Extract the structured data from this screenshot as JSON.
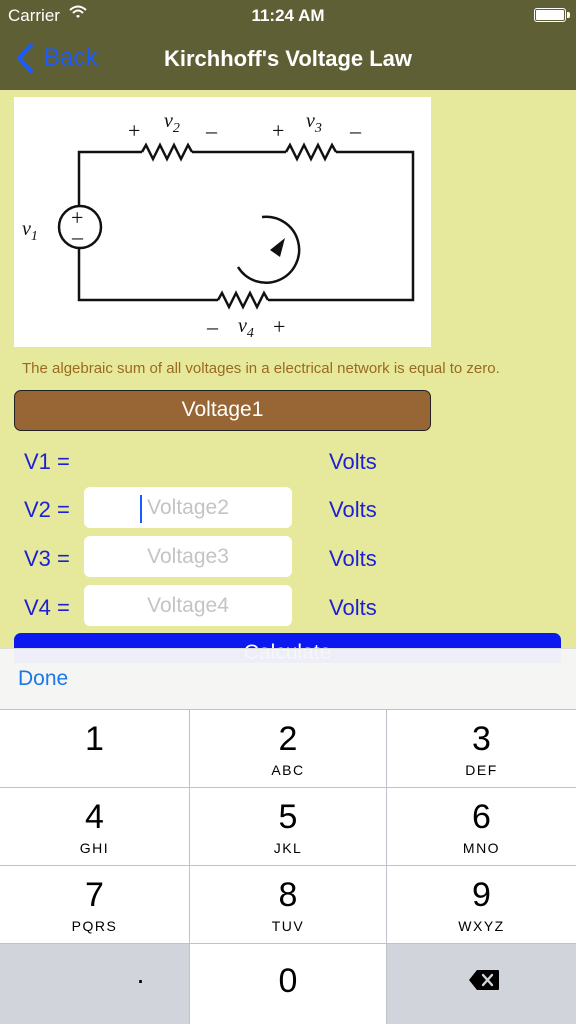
{
  "status": {
    "carrier": "Carrier",
    "time": "11:24 AM"
  },
  "nav": {
    "back_label": "Back",
    "title": "Kirchhoff's Voltage Law"
  },
  "circuit": {
    "plus": "+",
    "minus": "–",
    "v1": "v",
    "v1_sub": "1",
    "v2": "v",
    "v2_sub": "2",
    "v3": "v",
    "v3_sub": "3",
    "v4": "v",
    "v4_sub": "4"
  },
  "caption": "The algebraic sum of all voltages in a electrical network is equal to zero.",
  "voltage1_button": "Voltage1",
  "rows": [
    {
      "label": "V1 =",
      "unit": "Volts"
    },
    {
      "label": "V2 =",
      "placeholder": "Voltage2",
      "unit": "Volts"
    },
    {
      "label": "V3 =",
      "placeholder": "Voltage3",
      "unit": "Volts"
    },
    {
      "label": "V4 =",
      "placeholder": "Voltage4",
      "unit": "Volts"
    }
  ],
  "calculate_label": "Calculate",
  "keyboard": {
    "done_label": "Done",
    "keys": [
      {
        "num": "1",
        "letters": ""
      },
      {
        "num": "2",
        "letters": "ABC"
      },
      {
        "num": "3",
        "letters": "DEF"
      },
      {
        "num": "4",
        "letters": "GHI"
      },
      {
        "num": "5",
        "letters": "JKL"
      },
      {
        "num": "6",
        "letters": "MNO"
      },
      {
        "num": "7",
        "letters": "PQRS"
      },
      {
        "num": "8",
        "letters": "TUV"
      },
      {
        "num": "9",
        "letters": "WXYZ"
      },
      {
        "num": "0",
        "letters": ""
      }
    ],
    "decimal": ".",
    "delete_icon": "backspace-icon"
  },
  "colors": {
    "nav_bar": "#5f5f35",
    "background": "#e6e99b",
    "accent_blue": "#1a5cff",
    "label_blue": "#1d1fd6",
    "voltage_button": "#986535",
    "calculate_button": "#0b18f0"
  }
}
